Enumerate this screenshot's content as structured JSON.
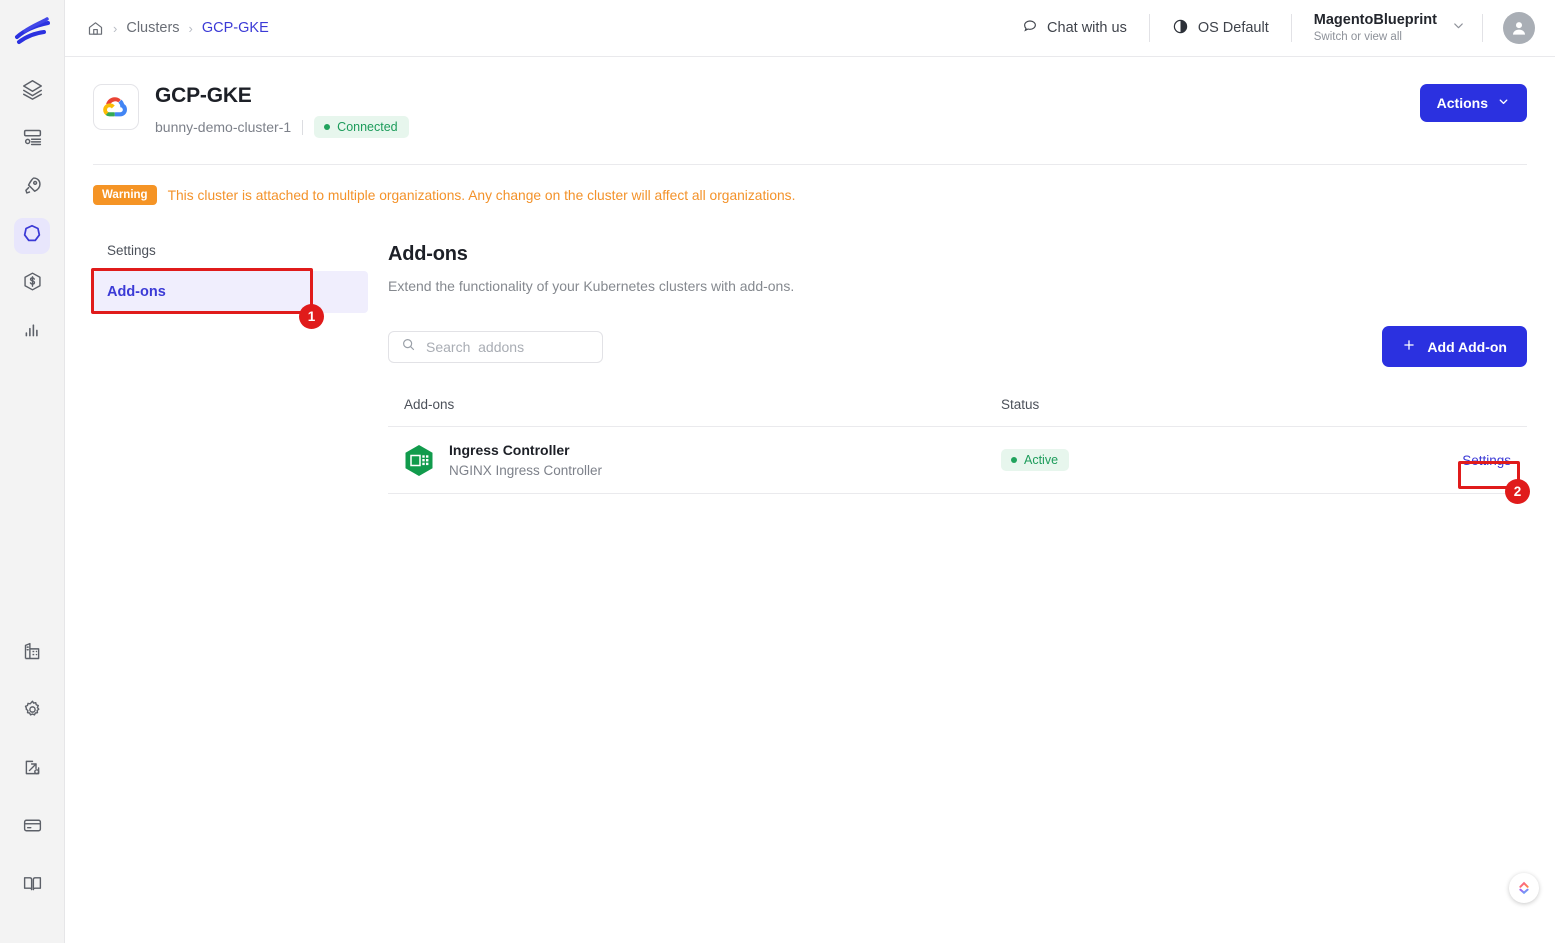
{
  "rail": {
    "logo_name": "brand-logo",
    "items": [
      {
        "name": "layers-icon",
        "label": "Stacks"
      },
      {
        "name": "server-icon",
        "label": "Environments"
      },
      {
        "name": "rocket-icon",
        "label": "Deployments"
      },
      {
        "name": "cluster-icon",
        "label": "Clusters",
        "active": true
      },
      {
        "name": "dollar-hex-icon",
        "label": "Costs"
      },
      {
        "name": "bar-chart-icon",
        "label": "Analytics"
      }
    ],
    "bottom_items": [
      {
        "name": "organization-icon",
        "label": "Organization"
      },
      {
        "name": "gear-icon",
        "label": "Settings"
      },
      {
        "name": "integrations-icon",
        "label": "Integrations"
      },
      {
        "name": "billing-card-icon",
        "label": "Billing"
      },
      {
        "name": "docs-book-icon",
        "label": "Docs"
      }
    ]
  },
  "topbar": {
    "breadcrumb": {
      "home_icon": "home-icon",
      "clusters": "Clusters",
      "current": "GCP-GKE"
    },
    "chat": "Chat with us",
    "theme": "OS Default",
    "org_name": "MagentoBlueprint",
    "org_sub": "Switch or view all"
  },
  "cluster": {
    "provider_icon": "google-cloud-icon",
    "title": "GCP-GKE",
    "name": "bunny-demo-cluster-1",
    "status": "Connected",
    "actions_label": "Actions"
  },
  "warning": {
    "tag": "Warning",
    "text": "This cluster is attached to multiple organizations. Any change on the cluster will affect all organizations."
  },
  "sidebar": {
    "section_label": "Settings",
    "items": [
      {
        "label": "Add-ons",
        "active": true
      }
    ]
  },
  "content": {
    "title": "Add-ons",
    "subtitle": "Extend the functionality of your Kubernetes clusters with add-ons.",
    "search_placeholder": "Search  addons",
    "search_value": "",
    "add_button": "Add Add-on",
    "table": {
      "columns": [
        "Add-ons",
        "Status",
        ""
      ],
      "rows": [
        {
          "icon": "nginx-addon-icon",
          "name": "Ingress Controller",
          "description": "NGINX Ingress Controller",
          "status": "Active",
          "action": "Settings"
        }
      ]
    }
  },
  "annotations": [
    {
      "id": "1",
      "target": "sidebar-add-ons"
    },
    {
      "id": "2",
      "target": "row-settings-link"
    }
  ],
  "colors": {
    "accent": "#2b31e0",
    "link": "#3b3ad6",
    "warning": "#f3922a",
    "success": "#21a35d",
    "highlight": "#e01b1b"
  }
}
